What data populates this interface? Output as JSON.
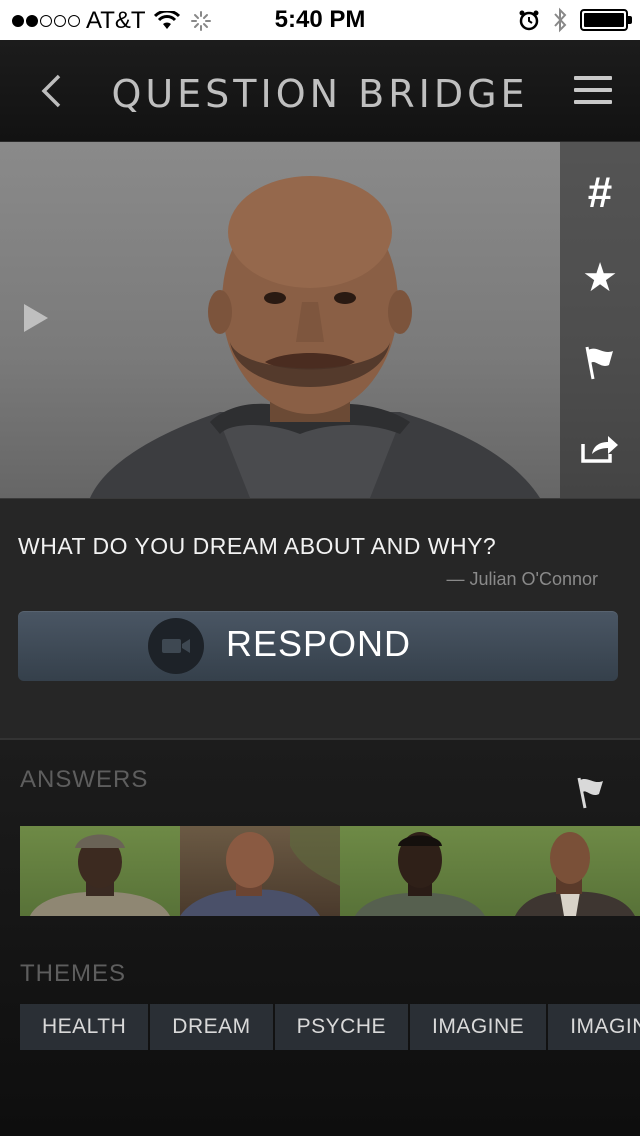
{
  "status_bar": {
    "carrier": "AT&T",
    "time": "5:40 PM",
    "signal_filled": 2,
    "signal_total": 5
  },
  "nav": {
    "title": "QUESTION BRIDGE",
    "back_icon": "chevron-left-icon",
    "menu_icon": "hamburger-menu-icon"
  },
  "video": {
    "play_icon": "play-icon",
    "actions": [
      {
        "name": "hashtag-button",
        "icon": "hashtag-icon",
        "glyph": "#"
      },
      {
        "name": "favorite-button",
        "icon": "star-icon",
        "glyph": "★"
      },
      {
        "name": "flag-button",
        "icon": "flag-icon",
        "glyph": ""
      },
      {
        "name": "share-button",
        "icon": "share-icon",
        "glyph": ""
      }
    ]
  },
  "question": {
    "text": "WHAT DO YOU DREAM ABOUT AND WHY?",
    "attribution": "— Julian O'Connor",
    "respond_label": "RESPOND",
    "respond_icon": "video-camera-icon"
  },
  "answers": {
    "label": "ANSWERS",
    "flag_icon": "flag-icon"
  },
  "themes": {
    "label": "THEMES",
    "items": [
      "HEALTH",
      "DREAM",
      "PSYCHE",
      "IMAGINE",
      "IMAGINE"
    ]
  },
  "colors": {
    "accent_button": "#3f4a56",
    "background": "#141414",
    "theme_pill": "#2a2f35"
  }
}
